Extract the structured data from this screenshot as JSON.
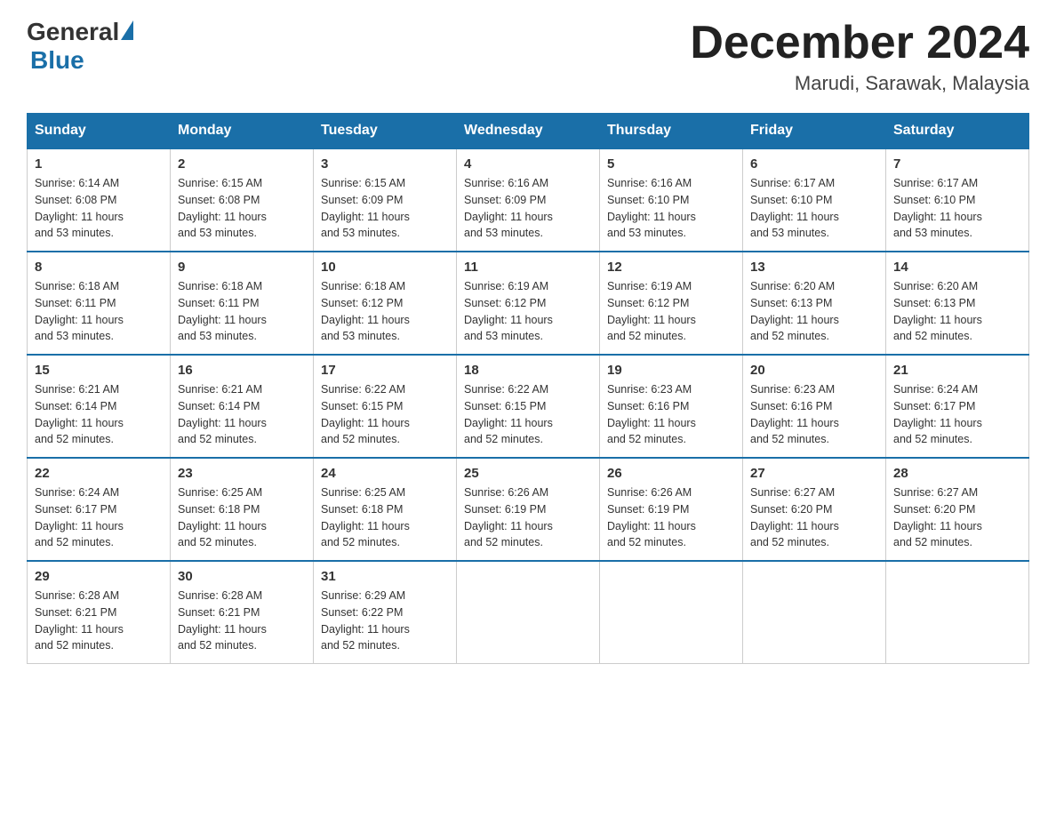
{
  "header": {
    "logo": {
      "general": "General",
      "blue": "Blue"
    },
    "title": "December 2024",
    "location": "Marudi, Sarawak, Malaysia"
  },
  "days_of_week": [
    "Sunday",
    "Monday",
    "Tuesday",
    "Wednesday",
    "Thursday",
    "Friday",
    "Saturday"
  ],
  "weeks": [
    [
      {
        "day": "1",
        "sunrise": "6:14 AM",
        "sunset": "6:08 PM",
        "daylight": "11 hours and 53 minutes."
      },
      {
        "day": "2",
        "sunrise": "6:15 AM",
        "sunset": "6:08 PM",
        "daylight": "11 hours and 53 minutes."
      },
      {
        "day": "3",
        "sunrise": "6:15 AM",
        "sunset": "6:09 PM",
        "daylight": "11 hours and 53 minutes."
      },
      {
        "day": "4",
        "sunrise": "6:16 AM",
        "sunset": "6:09 PM",
        "daylight": "11 hours and 53 minutes."
      },
      {
        "day": "5",
        "sunrise": "6:16 AM",
        "sunset": "6:10 PM",
        "daylight": "11 hours and 53 minutes."
      },
      {
        "day": "6",
        "sunrise": "6:17 AM",
        "sunset": "6:10 PM",
        "daylight": "11 hours and 53 minutes."
      },
      {
        "day": "7",
        "sunrise": "6:17 AM",
        "sunset": "6:10 PM",
        "daylight": "11 hours and 53 minutes."
      }
    ],
    [
      {
        "day": "8",
        "sunrise": "6:18 AM",
        "sunset": "6:11 PM",
        "daylight": "11 hours and 53 minutes."
      },
      {
        "day": "9",
        "sunrise": "6:18 AM",
        "sunset": "6:11 PM",
        "daylight": "11 hours and 53 minutes."
      },
      {
        "day": "10",
        "sunrise": "6:18 AM",
        "sunset": "6:12 PM",
        "daylight": "11 hours and 53 minutes."
      },
      {
        "day": "11",
        "sunrise": "6:19 AM",
        "sunset": "6:12 PM",
        "daylight": "11 hours and 53 minutes."
      },
      {
        "day": "12",
        "sunrise": "6:19 AM",
        "sunset": "6:12 PM",
        "daylight": "11 hours and 52 minutes."
      },
      {
        "day": "13",
        "sunrise": "6:20 AM",
        "sunset": "6:13 PM",
        "daylight": "11 hours and 52 minutes."
      },
      {
        "day": "14",
        "sunrise": "6:20 AM",
        "sunset": "6:13 PM",
        "daylight": "11 hours and 52 minutes."
      }
    ],
    [
      {
        "day": "15",
        "sunrise": "6:21 AM",
        "sunset": "6:14 PM",
        "daylight": "11 hours and 52 minutes."
      },
      {
        "day": "16",
        "sunrise": "6:21 AM",
        "sunset": "6:14 PM",
        "daylight": "11 hours and 52 minutes."
      },
      {
        "day": "17",
        "sunrise": "6:22 AM",
        "sunset": "6:15 PM",
        "daylight": "11 hours and 52 minutes."
      },
      {
        "day": "18",
        "sunrise": "6:22 AM",
        "sunset": "6:15 PM",
        "daylight": "11 hours and 52 minutes."
      },
      {
        "day": "19",
        "sunrise": "6:23 AM",
        "sunset": "6:16 PM",
        "daylight": "11 hours and 52 minutes."
      },
      {
        "day": "20",
        "sunrise": "6:23 AM",
        "sunset": "6:16 PM",
        "daylight": "11 hours and 52 minutes."
      },
      {
        "day": "21",
        "sunrise": "6:24 AM",
        "sunset": "6:17 PM",
        "daylight": "11 hours and 52 minutes."
      }
    ],
    [
      {
        "day": "22",
        "sunrise": "6:24 AM",
        "sunset": "6:17 PM",
        "daylight": "11 hours and 52 minutes."
      },
      {
        "day": "23",
        "sunrise": "6:25 AM",
        "sunset": "6:18 PM",
        "daylight": "11 hours and 52 minutes."
      },
      {
        "day": "24",
        "sunrise": "6:25 AM",
        "sunset": "6:18 PM",
        "daylight": "11 hours and 52 minutes."
      },
      {
        "day": "25",
        "sunrise": "6:26 AM",
        "sunset": "6:19 PM",
        "daylight": "11 hours and 52 minutes."
      },
      {
        "day": "26",
        "sunrise": "6:26 AM",
        "sunset": "6:19 PM",
        "daylight": "11 hours and 52 minutes."
      },
      {
        "day": "27",
        "sunrise": "6:27 AM",
        "sunset": "6:20 PM",
        "daylight": "11 hours and 52 minutes."
      },
      {
        "day": "28",
        "sunrise": "6:27 AM",
        "sunset": "6:20 PM",
        "daylight": "11 hours and 52 minutes."
      }
    ],
    [
      {
        "day": "29",
        "sunrise": "6:28 AM",
        "sunset": "6:21 PM",
        "daylight": "11 hours and 52 minutes."
      },
      {
        "day": "30",
        "sunrise": "6:28 AM",
        "sunset": "6:21 PM",
        "daylight": "11 hours and 52 minutes."
      },
      {
        "day": "31",
        "sunrise": "6:29 AM",
        "sunset": "6:22 PM",
        "daylight": "11 hours and 52 minutes."
      },
      null,
      null,
      null,
      null
    ]
  ],
  "labels": {
    "sunrise": "Sunrise:",
    "sunset": "Sunset:",
    "daylight": "Daylight:"
  }
}
